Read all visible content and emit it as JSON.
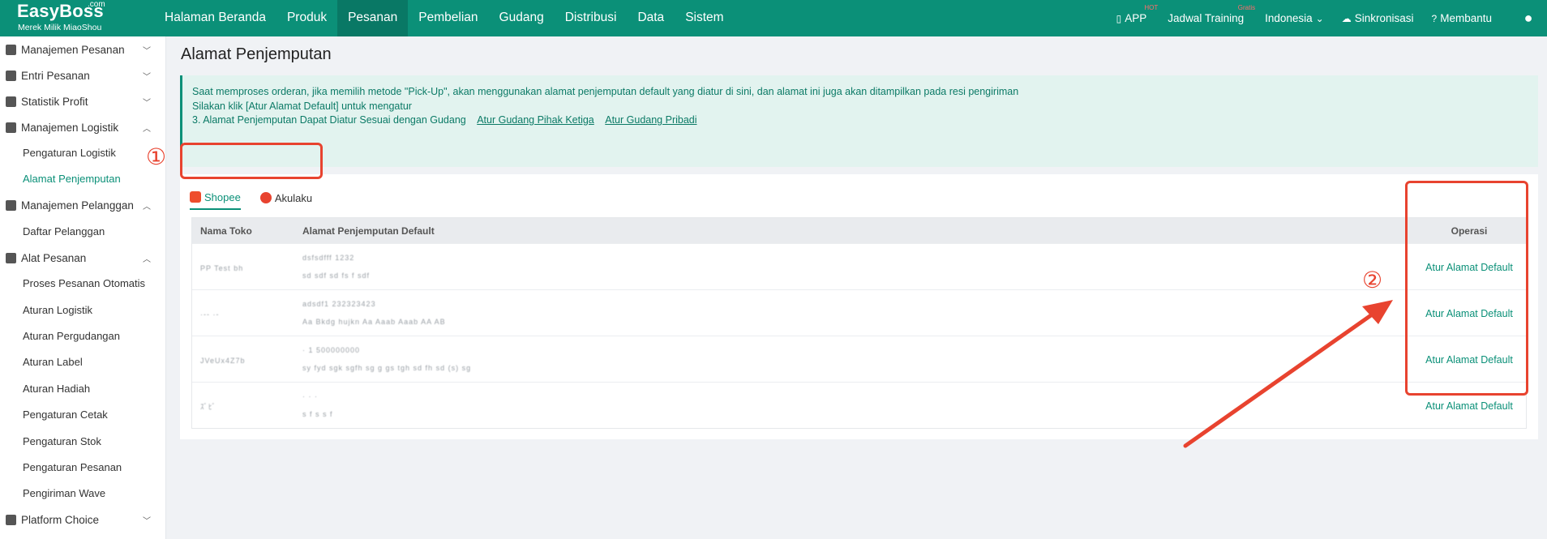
{
  "brand": {
    "name": "EasyBoss",
    "suffix": ".com",
    "tagline": "Merek Milik MiaoShou"
  },
  "nav": [
    "Halaman Beranda",
    "Produk",
    "Pesanan",
    "Pembelian",
    "Gudang",
    "Distribusi",
    "Data",
    "Sistem"
  ],
  "nav_active": "Pesanan",
  "top_right": {
    "app": "APP",
    "app_badge": "HOT",
    "training": "Jadwal Training",
    "training_badge": "Gratis",
    "language": "Indonesia",
    "sync": "Sinkronisasi",
    "help": "Membantu"
  },
  "sidebar": {
    "groups": [
      {
        "label": "Manajemen Pesanan",
        "expanded": false,
        "items": []
      },
      {
        "label": "Entri Pesanan",
        "expanded": false,
        "items": []
      },
      {
        "label": "Statistik Profit",
        "expanded": false,
        "items": []
      },
      {
        "label": "Manajemen Logistik",
        "expanded": true,
        "items": [
          "Pengaturan Logistik",
          "Alamat Penjemputan"
        ]
      },
      {
        "label": "Manajemen Pelanggan",
        "expanded": true,
        "items": [
          "Daftar Pelanggan"
        ]
      },
      {
        "label": "Alat Pesanan",
        "expanded": true,
        "items": [
          "Proses Pesanan Otomatis",
          "Aturan Logistik",
          "Aturan Pergudangan",
          "Aturan Label",
          "Aturan Hadiah",
          "Pengaturan Cetak",
          "Pengaturan Stok",
          "Pengaturan Pesanan",
          "Pengiriman Wave"
        ]
      },
      {
        "label": "Platform Choice",
        "expanded": false,
        "items": []
      }
    ],
    "active_item": "Alamat Penjemputan"
  },
  "page": {
    "title": "Alamat Penjemputan",
    "notice": {
      "line1": "Saat memproses orderan, jika memilih metode \"Pick-Up\", akan menggunakan alamat penjemputan default yang diatur di sini, dan alamat ini juga akan ditampilkan pada resi pengiriman",
      "line2": "Silakan klik [Atur Alamat Default] untuk mengatur",
      "line3": "3. Alamat Penjemputan Dapat Diatur Sesuai dengan Gudang",
      "link1": "Atur Gudang Pihak Ketiga",
      "link2": "Atur Gudang Pribadi"
    },
    "tabs": [
      "Shopee",
      "Akulaku"
    ],
    "active_tab": "Shopee",
    "table": {
      "columns": [
        "Nama Toko",
        "Alamat Penjemputan Default",
        "Operasi"
      ],
      "rows": [
        {
          "store": "PP Test bh",
          "addr1": "dsfsdfff 1232",
          "addr2": "sd sdf sd fs f sdf",
          "action": "Atur Alamat Default"
        },
        {
          "store": "·-- ·-",
          "addr1": "adsdf1 232323423",
          "addr2": "Aa Bkdg hujkn Aa Aaab Aaab AA AB",
          "action": "Atur Alamat Default"
        },
        {
          "store": "JVeUx4Z7b",
          "addr1": "· 1 500000000",
          "addr2": "sy fyd sgk sgfh sg g gs tgh sd fh sd (s) sg",
          "action": "Atur Alamat Default"
        },
        {
          "store": "ｽﾞﾋﾞ",
          "addr1": "· · ·",
          "addr2": "s f s s f",
          "action": "Atur Alamat Default"
        }
      ]
    }
  },
  "annotations": {
    "num1": "①",
    "num2": "②",
    "color": "#e8432f"
  },
  "colors": {
    "primary": "#0b9078",
    "primary_dark": "#097865",
    "notice_bg": "#e2f3ef",
    "annotation": "#e8432f"
  }
}
